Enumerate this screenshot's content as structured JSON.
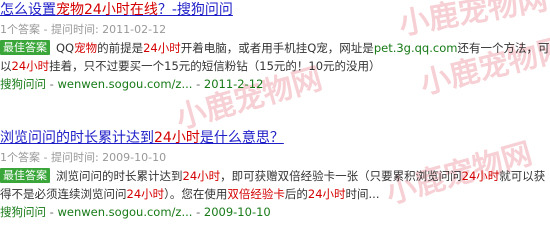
{
  "results": [
    {
      "title_parts": [
        "怎么设置",
        "宠物",
        "24小时",
        "在线",
        "？-搜狗问问"
      ],
      "answer_count": "1个答案",
      "date_label": "提问时间: 2011-02-12",
      "badge": "最佳答案",
      "body_parts": [
        "QQ",
        "宠物",
        "的前提是",
        "24小时",
        "开着电脑，或者用手机挂Q宠，网址是",
        "pet.3g.qq.com",
        "还有一个方法，可以",
        "24小时",
        "挂着，只不过要买一个15元的短信粉钻（15元的！10元的没用）"
      ],
      "source_name": "搜狗问问",
      "source_url": "wenwen.sogou.com/z...",
      "source_date": "2011-2-12"
    },
    {
      "title_parts": [
        "浏览问问的时长累计达到",
        "24小时",
        "是什么意思？"
      ],
      "answer_count": "1个答案",
      "date_label": "提问时间: 2009-10-10",
      "badge": "最佳答案",
      "body_parts": [
        "浏览问问的时长累计达到",
        "24小时",
        "，即可获赠双倍经验卡一张（只要累积浏览问问",
        "24小时",
        "就可以获得不是必须连续浏览问问",
        "24小时",
        "）。您在使用",
        "双倍经验卡",
        "后的",
        "24小时",
        "时间..."
      ],
      "source_name": "搜狗问问",
      "source_url": "wenwen.sogou.com/z...",
      "source_date": "2009-10-10"
    }
  ],
  "separator": " - ",
  "watermark": "小鹿宠物网"
}
